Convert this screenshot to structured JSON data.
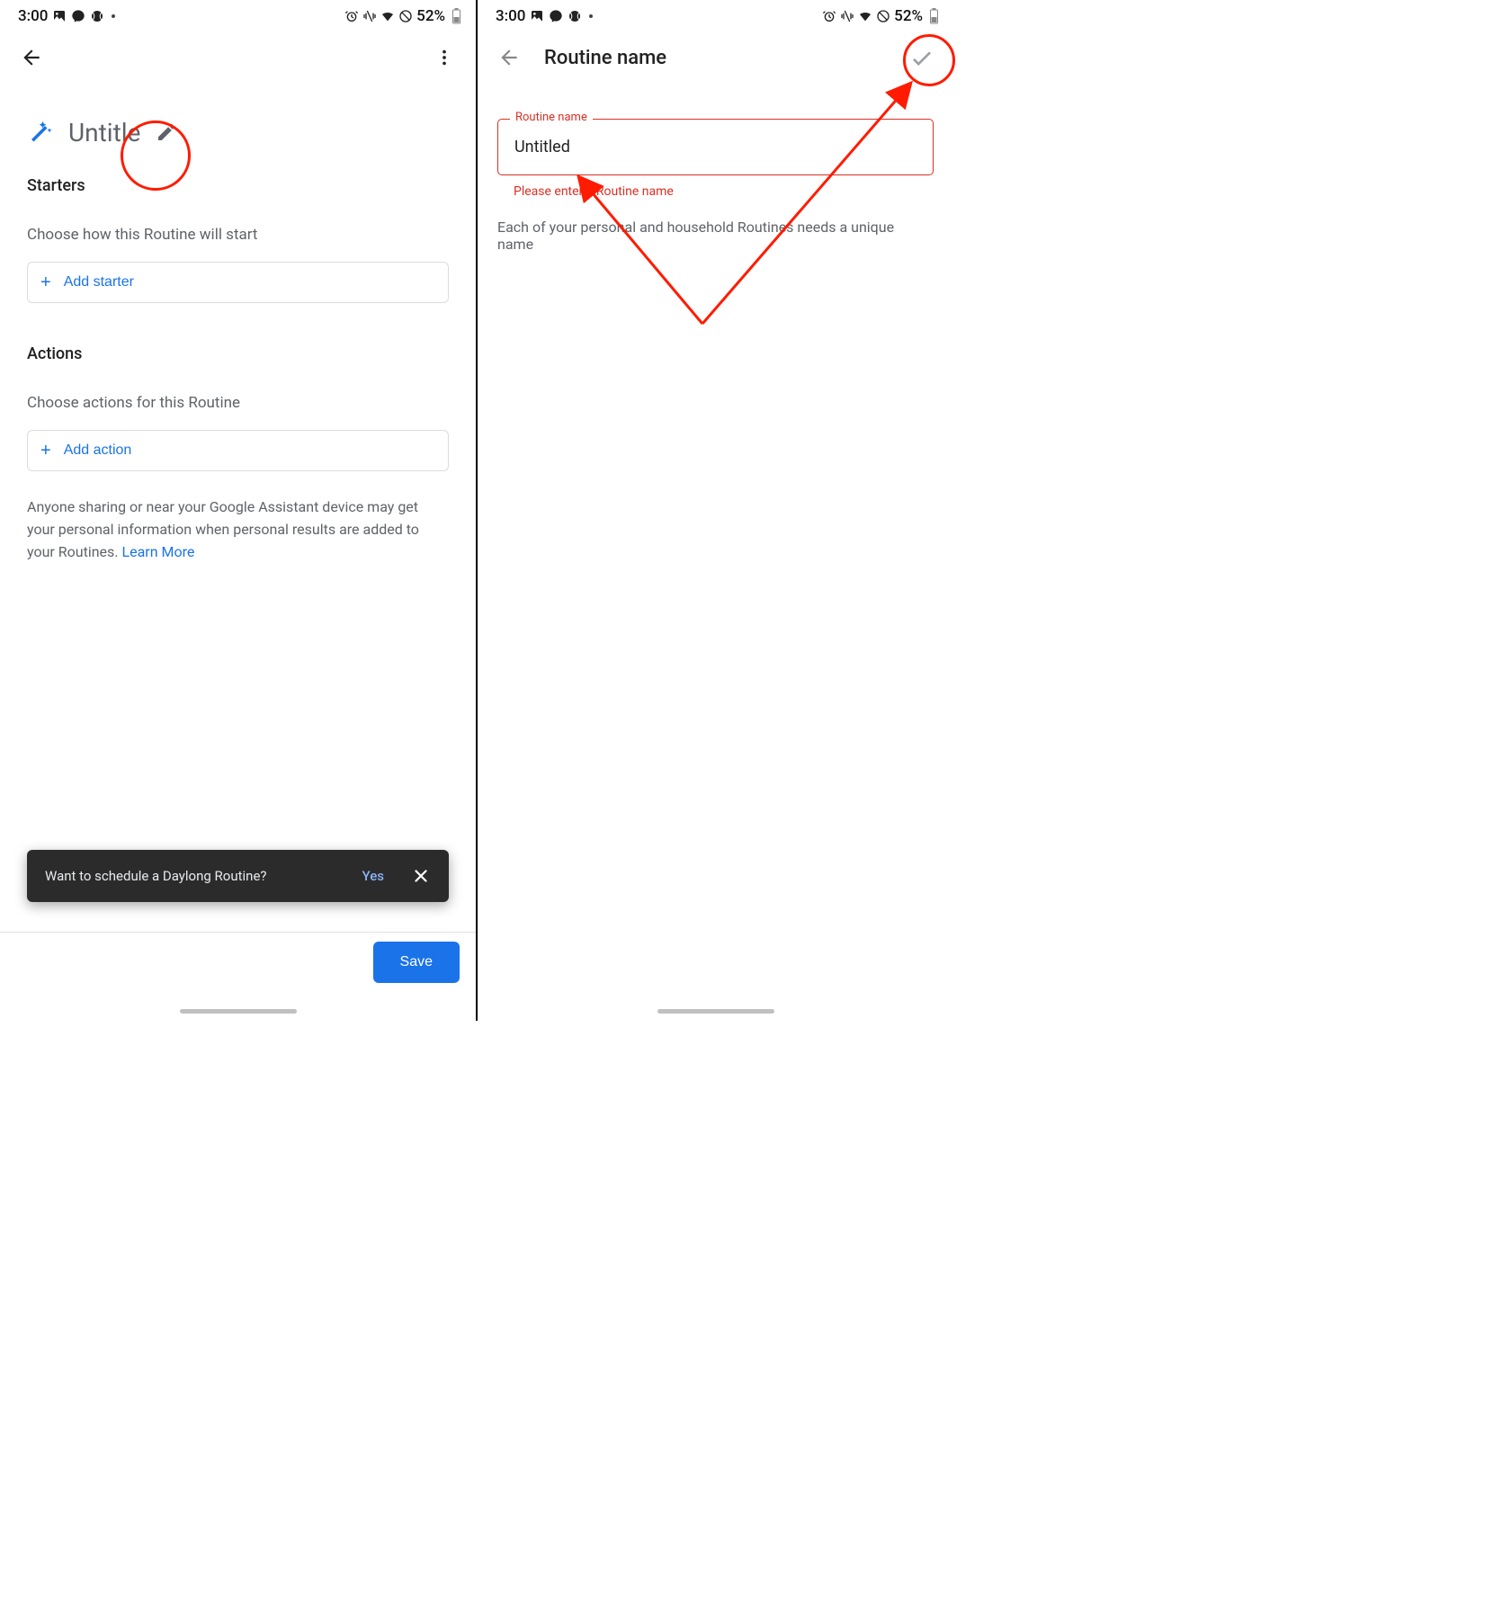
{
  "status": {
    "time": "3:00",
    "battery": "52%"
  },
  "left": {
    "routine_title": "Untitle",
    "starters": {
      "heading": "Starters",
      "sub": "Choose how this Routine will start",
      "add_label": "Add starter"
    },
    "actions": {
      "heading": "Actions",
      "sub": "Choose actions for this Routine",
      "add_label": "Add action"
    },
    "disclaimer_prefix": "Anyone sharing or near your Google Assistant device may get your personal information when personal results are added to your Routines. ",
    "disclaimer_link": "Learn More",
    "snackbar": {
      "message": "Want to schedule a Daylong Routine?",
      "yes": "Yes"
    },
    "save_label": "Save"
  },
  "right": {
    "app_title": "Routine name",
    "field_label": "Routine name",
    "field_value": "Untitled",
    "field_error": "Please enter a Routine name",
    "help": "Each of your personal and household Routines needs a unique name"
  },
  "icons": {
    "wand": "magic-wand-icon",
    "pencil": "pencil-icon",
    "back": "back-arrow-icon",
    "more": "more-vert-icon",
    "check": "check-icon",
    "close": "close-icon"
  }
}
